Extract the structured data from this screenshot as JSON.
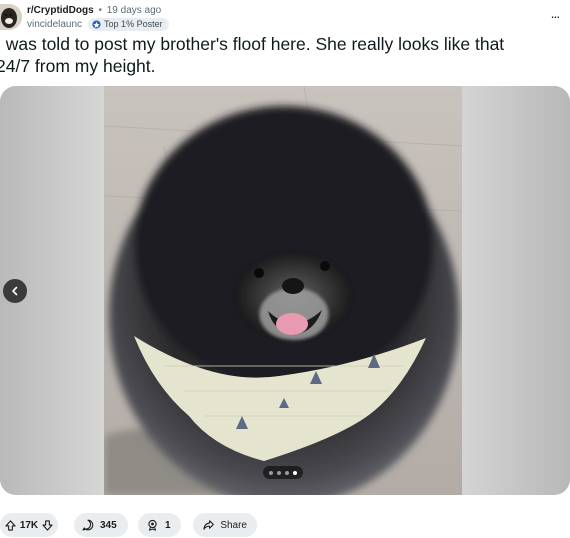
{
  "post": {
    "subreddit": "r/CryptidDogs",
    "separator": "•",
    "time_ago": "19 days ago",
    "author": "vincidelaunc",
    "flair": "Top 1% Poster",
    "more_label": "...",
    "title_line1": "I was told to post my brother's floof here. She really looks like that",
    "title_line2": "24/7 from my height."
  },
  "gallery": {
    "image_subject": "fluffy black pomeranian dog wearing a light bandana with triangle print",
    "slide_count": 4,
    "active_slide": 4,
    "prev_icon": "chevron-left-icon"
  },
  "actions": {
    "votes": "17K",
    "comments": "345",
    "awards": "1",
    "share_label": "Share"
  },
  "colors": {
    "pill_bg": "#eaedef",
    "text": "#1a1a1b",
    "muted": "#576f76"
  }
}
